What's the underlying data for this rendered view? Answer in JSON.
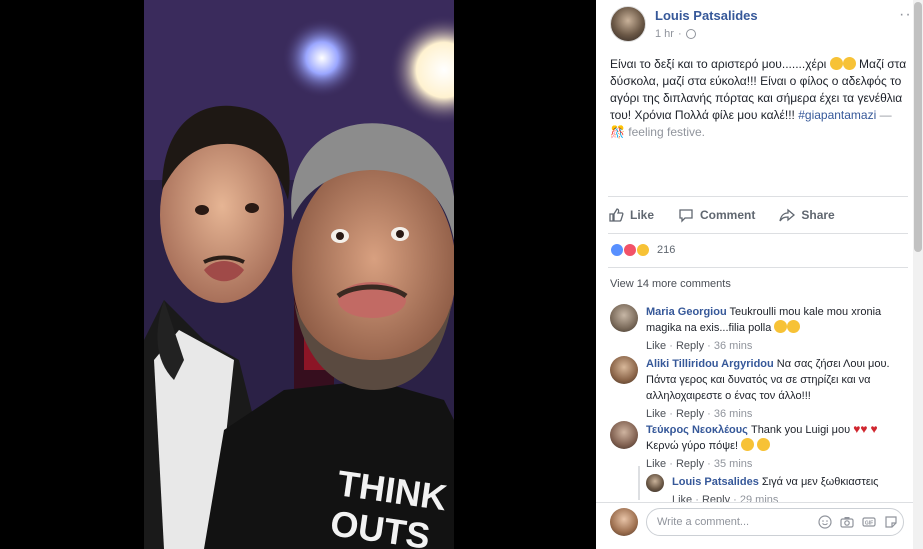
{
  "post": {
    "author": "Louis Patsalides",
    "time": "1 hr",
    "more": "···",
    "text_main": "Είναι το δεξί και το αριστερό μου.......χέρι ",
    "text_mid": " Μαζί στα δύσκολα, μαζί στα εύκολα!!! Είναι ο φίλος ο αδελφός το αγόρι της διπλανής πόρτας και σήμερα έχει τα γενέθλια του! Χρόνια Πολλά φίλε μου καλέ!!! ",
    "hashtag": "#giapantamazi",
    "dash": " — ",
    "feeling": " feeling festive.",
    "icons": [
      "globe-icon",
      "more-options-icon"
    ]
  },
  "actions": {
    "like": "Like",
    "comment": "Comment",
    "share": "Share"
  },
  "reactions": {
    "count": "216",
    "types": [
      "like",
      "love",
      "wow"
    ],
    "colors": {
      "like": "#5890ff",
      "love": "#f25268",
      "wow": "#f7c236"
    }
  },
  "comments": {
    "view_more": "View 14 more comments",
    "like_label": "Like",
    "reply_label": "Reply",
    "sep": " · ",
    "items": [
      {
        "name": "Maria Georgiou",
        "text": "Teukroulli mou kale mou xronia magika na exis...filia polla",
        "time": "36 mins"
      },
      {
        "name": "Aliki Tilliridou Argyridou",
        "text": "Να σας ζήσει Λουι μου. Πάντα γερος και δυνατός να σε στηρίζει και να αλληλοχαιρεστε ο ένας τον άλλο!!!",
        "time": "36 mins"
      },
      {
        "name": "Τεύκρος Νεοκλέους",
        "text_a": "Thank you Luigi μου",
        "text_b": " Κερνώ γύρο πόψε! ",
        "time": "35 mins"
      }
    ],
    "reply": {
      "name": "Louis Patsalides",
      "text": "Σιγά να μεν ξωθκιαστεις",
      "time": "29 mins"
    }
  },
  "write": {
    "placeholder": "Write a comment...",
    "icons": [
      "emoji-icon",
      "camera-icon",
      "gif-icon",
      "sticker-icon"
    ]
  },
  "photo": {
    "shirt_text_1": "THINK",
    "shirt_text_2": "OUTS"
  },
  "colors": {
    "link": "#365899",
    "meta": "#90949c",
    "text": "#1d2129"
  }
}
